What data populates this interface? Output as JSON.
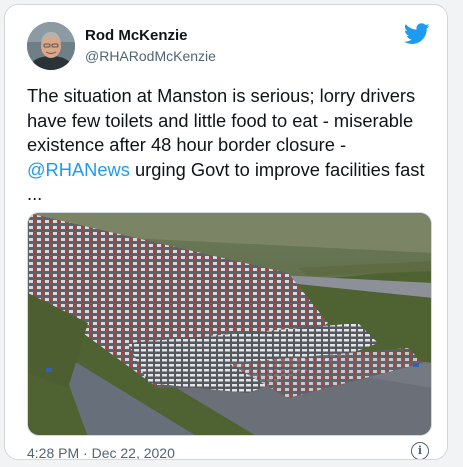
{
  "tweet": {
    "author_name": "Rod McKenzie",
    "author_handle": "@RHARodMcKenzie",
    "text_before": "The situation at Manston is serious; lorry drivers have few toilets and little food to eat - miserable existence after 48 hour border closure - ",
    "mention": "@RHANews",
    "text_after": " urging Govt to improve facilities fast ...",
    "timestamp": "4:28 PM · Dec 22, 2020"
  },
  "icons": {
    "brand": "twitter-bird-icon",
    "info": "info-icon"
  },
  "colors": {
    "accent": "#1d9bf0",
    "text": "#0f1419",
    "secondary": "#536471",
    "border": "#cfd9de"
  }
}
